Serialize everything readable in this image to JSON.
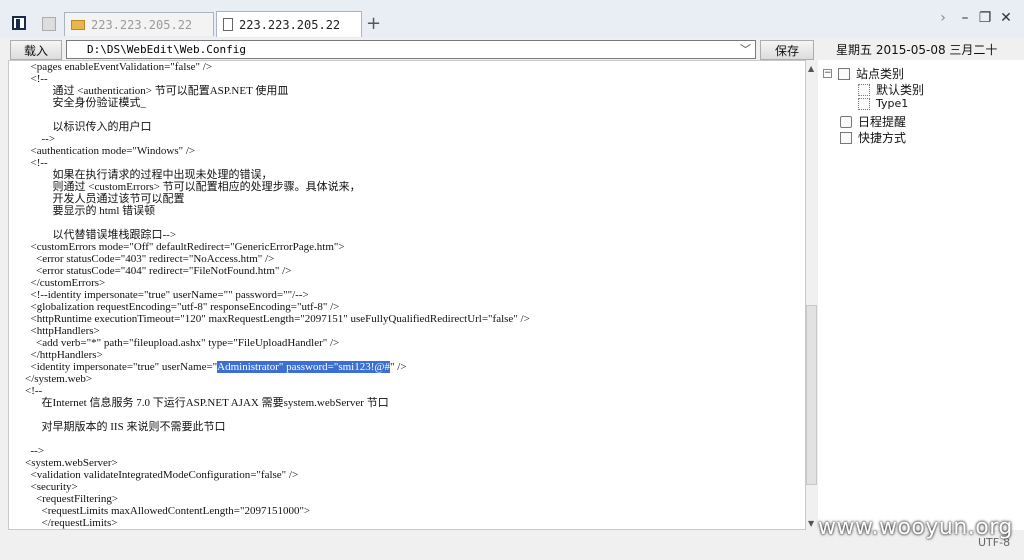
{
  "tabs": [
    {
      "label": "223.223.205.22",
      "active": false
    },
    {
      "label": "223.223.205.22",
      "active": true
    }
  ],
  "toolbar": {
    "load_label": "载入",
    "path_value": "D:\\DS\\WebEdit\\Web.Config",
    "save_label": "保存"
  },
  "date": {
    "weekday": "星期五",
    "date": "2015-05-08",
    "lunar": "三月二十"
  },
  "code_lines": [
    "  <pages enableEventValidation=\"false\" />",
    "  <!--",
    "          通过 <authentication> 节可以配置ASP.NET 使用皿",
    "          安全身份验证模式_",
    "",
    "          以标识传入的用户口",
    "      -->",
    "  <authentication mode=\"Windows\" />",
    "  <!--",
    "          如果在执行请求的过程中出现未处理的错误，",
    "          则通过 <customErrors> 节可以配置相应的处理步骤。具体说来，",
    "          开发人员通过该节可以配置",
    "          要显示的 html 错误顿",
    "",
    "          以代替错误堆栈跟踪口-->",
    "  <customErrors mode=\"Off\" defaultRedirect=\"GenericErrorPage.htm\">",
    "    <error statusCode=\"403\" redirect=\"NoAccess.htm\" />",
    "    <error statusCode=\"404\" redirect=\"FileNotFound.htm\" />",
    "  </customErrors>",
    "  <!--identity impersonate=\"true\" userName=\"\" password=\"\"/-->",
    "  <globalization requestEncoding=\"utf-8\" responseEncoding=\"utf-8\" />",
    "  <httpRuntime executionTimeout=\"120\" maxRequestLength=\"2097151\" useFullyQualifiedRedirectUrl=\"false\" />",
    "  <httpHandlers>",
    "    <add verb=\"*\" path=\"fileupload.ashx\" type=\"FileUploadHandler\" />",
    "  </httpHandlers>",
    "  <identity impersonate=\"true\" userName=\"Administrator\" password=\"smi123!@#\" />",
    "</system.web>",
    "<!--",
    "      在Internet 信息服务 7.0 下运行ASP.NET AJAX 需要system.webServer 节口",
    "",
    "      对早期版本的 IIS 来说则不需要此节口",
    "",
    "  -->",
    "<system.webServer>",
    "  <validation validateIntegratedModeConfiguration=\"false\" />",
    "  <security>",
    "    <requestFiltering>",
    "      <requestLimits maxAllowedContentLength=\"2097151000\">",
    "      </requestLimits>"
  ],
  "selection": {
    "line_index": 25,
    "text": "Administrator\" password=\"smi123!@#"
  },
  "tree": [
    {
      "label": "站点类别",
      "icon": "category-icon",
      "expander": "minus",
      "level": 0
    },
    {
      "label": "默认类别",
      "icon": "dotted-box-icon",
      "level": 1
    },
    {
      "label": "Type1",
      "icon": "dotted-box-icon",
      "level": 1
    },
    {
      "label": "日程提醒",
      "icon": "clock-icon",
      "level": 0
    },
    {
      "label": "快捷方式",
      "icon": "shortcut-icon",
      "level": 0
    }
  ],
  "watermark": "www.wooyun.org",
  "encoding": "UTF-8"
}
